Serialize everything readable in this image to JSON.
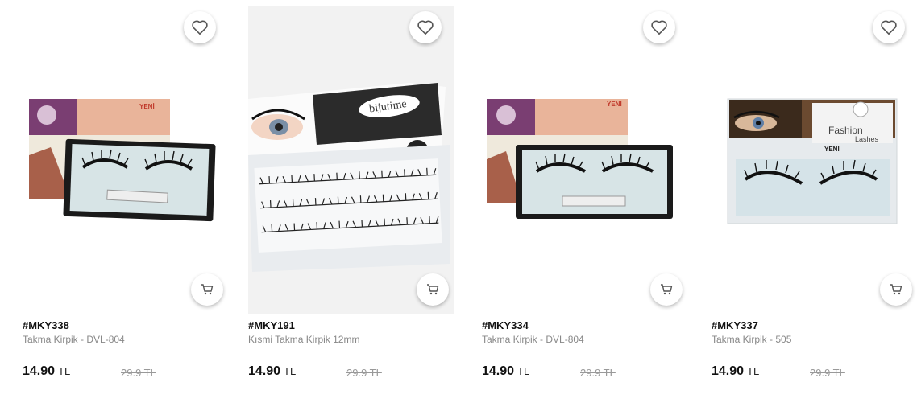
{
  "products": [
    {
      "sku": "#MKY338",
      "name": "Takma Kirpik - DVL-804",
      "price": "14.90",
      "currency": "TL",
      "old_price": "29.9 TL",
      "badge": "YENİ",
      "fav_icon": "heart-icon",
      "cart_icon": "cart-icon"
    },
    {
      "sku": "#MKY191",
      "name": "Kısmi Takma Kirpik 12mm",
      "price": "14.90",
      "currency": "TL",
      "old_price": "29.9 TL",
      "brand": "bijutime",
      "size": "12mm",
      "fav_icon": "heart-icon",
      "cart_icon": "cart-icon"
    },
    {
      "sku": "#MKY334",
      "name": "Takma Kirpik - DVL-804",
      "price": "14.90",
      "currency": "TL",
      "old_price": "29.9 TL",
      "badge": "YENİ",
      "fav_icon": "heart-icon",
      "cart_icon": "cart-icon"
    },
    {
      "sku": "#MKY337",
      "name": "Takma Kirpik - 505",
      "price": "14.90",
      "currency": "TL",
      "old_price": "29.9 TL",
      "badge": "YENİ",
      "package_title": "Fashion",
      "package_subtitle": "Lashes",
      "fav_icon": "heart-icon",
      "cart_icon": "cart-icon"
    }
  ]
}
